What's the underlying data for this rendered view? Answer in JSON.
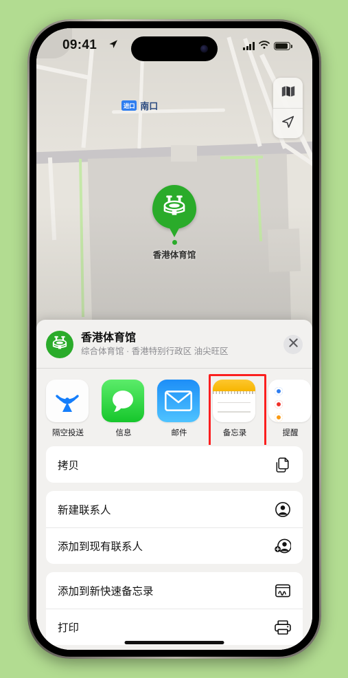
{
  "statusbar": {
    "time": "09:41",
    "location_arrow_icon": "location-arrow-icon",
    "cellular_icon": "cellular-bars-icon",
    "wifi_icon": "wifi-icon",
    "battery_icon": "battery-icon"
  },
  "map": {
    "exit_badge": "进口",
    "exit_label": "南口",
    "layers_icon": "map-layers-icon",
    "locate_icon": "location-arrow-icon",
    "pin": {
      "icon": "stadium-icon",
      "label": "香港体育馆"
    }
  },
  "sheet": {
    "header": {
      "icon": "stadium-icon",
      "title": "香港体育馆",
      "subtitle": "综合体育馆 · 香港特别行政区 油尖旺区",
      "close_icon": "close-icon"
    },
    "apps": [
      {
        "label": "隔空投送",
        "icon": "airdrop-icon",
        "highlighted": false
      },
      {
        "label": "信息",
        "icon": "messages-icon",
        "highlighted": false
      },
      {
        "label": "邮件",
        "icon": "mail-icon",
        "highlighted": false
      },
      {
        "label": "备忘录",
        "icon": "notes-icon",
        "highlighted": true
      },
      {
        "label": "提醒",
        "icon": "reminders-icon",
        "highlighted": false
      }
    ],
    "groups": [
      {
        "rows": [
          {
            "label": "拷贝",
            "icon": "copy-icon"
          }
        ]
      },
      {
        "rows": [
          {
            "label": "新建联系人",
            "icon": "person-circle-icon"
          },
          {
            "label": "添加到现有联系人",
            "icon": "person-add-icon"
          }
        ]
      },
      {
        "rows": [
          {
            "label": "添加到新快速备忘录",
            "icon": "quick-note-icon"
          },
          {
            "label": "打印",
            "icon": "printer-icon"
          }
        ]
      }
    ]
  },
  "colors": {
    "background": "#b2dc91",
    "accent_green": "#2aab2a",
    "highlight_red": "#fb1f1f",
    "badge_blue": "#2f7ef0"
  }
}
